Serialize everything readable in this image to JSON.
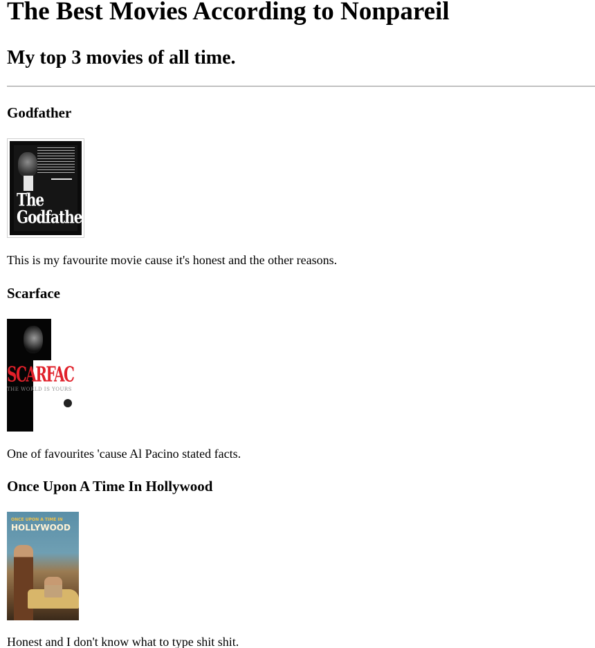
{
  "page": {
    "title": "The Best Movies According to Nonpareil",
    "subtitle": "My top 3 movies of all time."
  },
  "movies": [
    {
      "name": "Godfather",
      "poster": {
        "alt_icon": "godfather-poster",
        "title_line1": "The",
        "title_line2": "Godfather"
      },
      "description": "This is my favourite movie cause it's honest and the other reasons."
    },
    {
      "name": "Scarface",
      "poster": {
        "alt_icon": "scarface-poster",
        "title": "SCARFACE",
        "tagline": "THE WORLD IS YOURS"
      },
      "description": "One of favourites 'cause Al Pacino stated facts."
    },
    {
      "name": "Once Upon A Time In Hollywood",
      "poster": {
        "alt_icon": "ouatih-poster",
        "title_small": "ONCE UPON A TIME IN",
        "title_big": "HOLLYWOOD"
      },
      "description": "Honest and I don't know what to type shit shit."
    }
  ],
  "colors": {
    "text": "#000000",
    "background": "#ffffff",
    "rule": "#9a9a9a",
    "scarface_red": "#e0202a"
  }
}
